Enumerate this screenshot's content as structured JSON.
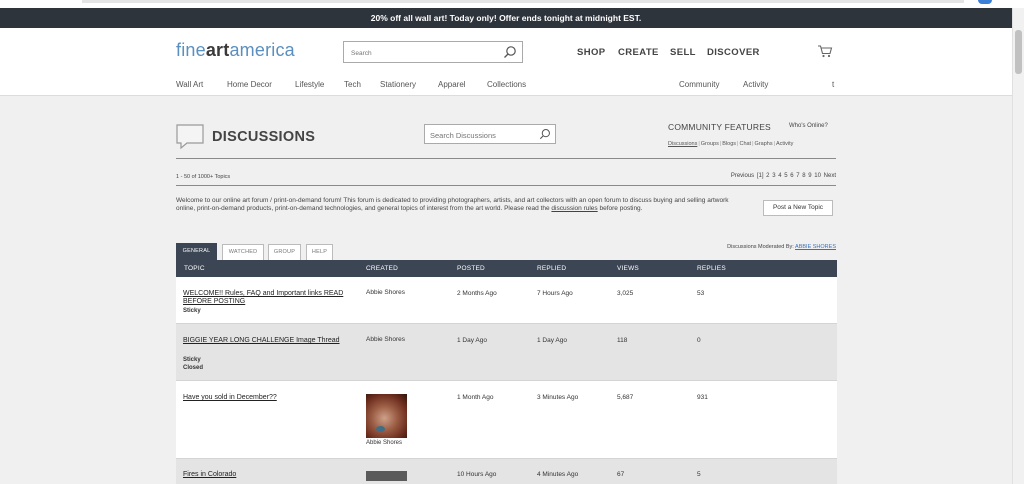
{
  "promo": {
    "text": "20% off all wall art!   Today only!   Offer ends tonight at midnight EST."
  },
  "header": {
    "logo": {
      "part1": "fine",
      "part2": "art",
      "part3": "america"
    },
    "search_placeholder": "Search",
    "nav": [
      "SHOP",
      "CREATE",
      "SELL",
      "DISCOVER"
    ],
    "subnav_left": [
      "Wall Art",
      "Home Decor",
      "Lifestyle",
      "Tech",
      "Stationery",
      "Apparel",
      "Collections"
    ],
    "subnav_right": [
      "Community",
      "Activity",
      "t"
    ]
  },
  "discussions": {
    "title": "DISCUSSIONS",
    "search_placeholder": "Search Discussions",
    "community_features": "COMMUNITY FEATURES",
    "whos_online": "Who's Online?",
    "feature_links": [
      "Discussions",
      "Groups",
      "Blogs",
      "Chat",
      "Graphs",
      "Activity"
    ],
    "topic_count": "1 - 50 of 1000+ Topics",
    "pager": {
      "previous": "Previous",
      "current": "[1]",
      "pages": [
        "2",
        "3",
        "4",
        "5",
        "6",
        "7",
        "8",
        "9",
        "10"
      ],
      "next": "Next"
    },
    "intro": {
      "text": "Welcome to our online art forum / print-on-demand forum!  This forum is dedicated to providing photographers, artists, and art collectors with an open forum to discuss buying and selling artwork online, print-on-demand products, print-on-demand technologies, and general topics of interest from the art world.   Please read the ",
      "link": "discussion rules",
      "after": " before posting."
    },
    "post_button": "Post a New Topic",
    "tabs": [
      "GENERAL",
      "WATCHED",
      "GROUP",
      "HELP"
    ],
    "moderated_label": "Discussions Moderated By:",
    "moderator": "ABBIE SHORES",
    "columns": [
      "TOPIC",
      "CREATED",
      "POSTED",
      "REPLIED",
      "VIEWS",
      "REPLIES"
    ],
    "rows": [
      {
        "topic": "WELCOME!! Rules, FAQ and Important links READ BEFORE POSTING",
        "flags": [
          "Sticky"
        ],
        "created": "Abbie Shores",
        "posted": "2 Months Ago",
        "replied": "7 Hours Ago",
        "views": "3,025",
        "replies": "53"
      },
      {
        "topic": "BIGGIE YEAR LONG CHALLENGE Image Thread",
        "flags": [
          "Sticky",
          "Closed"
        ],
        "created": "Abbie Shores",
        "posted": "1 Day Ago",
        "replied": "1 Day Ago",
        "views": "118",
        "replies": "0"
      },
      {
        "topic": "Have you sold in December??",
        "flags": [],
        "created": "Abbie Shores",
        "posted": "1 Month Ago",
        "replied": "3 Minutes Ago",
        "views": "5,687",
        "replies": "931"
      },
      {
        "topic": "Fires in Colorado",
        "flags": [],
        "created": "",
        "posted": "10 Hours Ago",
        "replied": "4 Minutes Ago",
        "views": "67",
        "replies": "5"
      }
    ]
  }
}
